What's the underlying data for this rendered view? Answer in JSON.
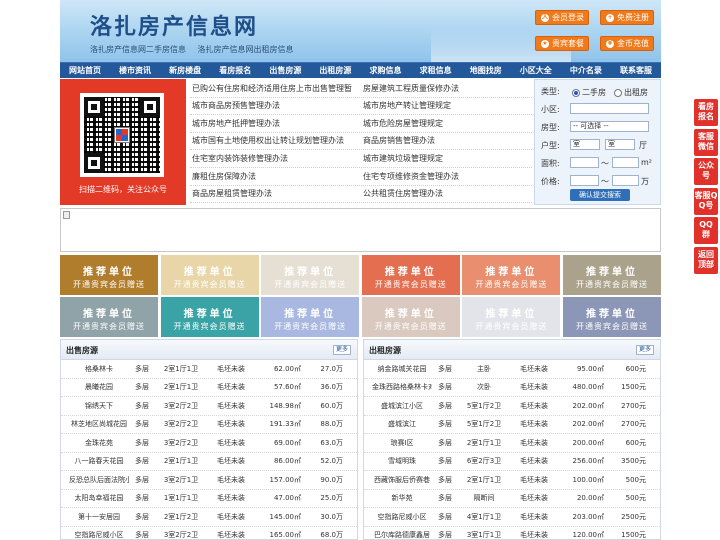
{
  "header": {
    "site_title": "洛扎房产信息网",
    "slogans": [
      "洛扎房产信息网二手房信息",
      "洛扎房产信息网出租房信息"
    ],
    "buttons": {
      "login": "会员登录",
      "register": "免费注册",
      "vip": "贵宾套餐",
      "recharge": "金币充值"
    }
  },
  "nav": [
    "网站首页",
    "楼市资讯",
    "新房楼盘",
    "看房报名",
    "出售房源",
    "出租房源",
    "求购信息",
    "求租信息",
    "地图找房",
    "小区大全",
    "中介名录",
    "联系客服"
  ],
  "qr": {
    "caption": "扫描二维码，关注公众号"
  },
  "links": [
    [
      "已购公有住房和经济适用住房上市出售管理暂",
      "房屋建筑工程质量保修办法"
    ],
    [
      "城市商品房预售管理办法",
      "城市房地产转让管理规定"
    ],
    [
      "城市房地产抵押管理办法",
      "城市危险房屋管理规定"
    ],
    [
      "城市国有土地使用权出让转让规划管理办法",
      "商品房销售管理办法"
    ],
    [
      "住宅室内装饰装修管理办法",
      "城市建筑垃圾管理规定"
    ],
    [
      "廉租住房保障办法",
      "住宅专项维修资金管理办法"
    ],
    [
      "商品房屋租赁管理办法",
      "公共租赁住房管理办法"
    ]
  ],
  "search": {
    "type_label": "类型:",
    "type_options": [
      "二手房",
      "出租房"
    ],
    "selected_type": "二手房",
    "community_label": "小区:",
    "house_label": "房型:",
    "house_select": "-- 可选择 --",
    "layout_label": "户型:",
    "room_select": "室",
    "hall_select": "室",
    "hall_unit": "厅",
    "area_label": "面积:",
    "area_sep": "〜",
    "area_unit": "m²",
    "price_label": "价格:",
    "price_sep": "〜",
    "price_unit": "万",
    "submit": "确认提交搜索"
  },
  "promo": {
    "title": "推荐单位",
    "subtitle": "开通贵宾会员赠送",
    "row1_colors": [
      "#b07d2c",
      "#e8d6a8",
      "#e6e0d4",
      "#e46f50",
      "#e98e6e",
      "#aaa28a"
    ],
    "row2_colors": [
      "#8fa3a8",
      "#3aa3a6",
      "#a9b8e0",
      "#d9c9bf",
      "#e2e4ea",
      "#8c96b6"
    ]
  },
  "sale": {
    "title": "出售房源",
    "more": "更多",
    "rows": [
      [
        "格桑林卡",
        "多层",
        "2室1厅1卫",
        "毛坯未装",
        "62.00㎡",
        "27.0万"
      ],
      [
        "晨曦花园",
        "多层",
        "2室1厅1卫",
        "毛坯未装",
        "57.60㎡",
        "36.0万"
      ],
      [
        "锦绣天下",
        "多层",
        "3室2厅2卫",
        "毛坯未装",
        "148.98㎡",
        "60.0万"
      ],
      [
        "林芝地区尚城花园",
        "多层",
        "3室2厅2卫",
        "毛坯未装",
        "191.33㎡",
        "88.0万"
      ],
      [
        "金珠花苑",
        "多层",
        "3室2厅2卫",
        "毛坯未装",
        "69.00㎡",
        "63.0万"
      ],
      [
        "八一路春天花园",
        "多层",
        "2室1厅1卫",
        "毛坯未装",
        "86.00㎡",
        "52.0万"
      ],
      [
        "反恐总队后面法院小区",
        "多层",
        "3室2厅1卫",
        "毛坯未装",
        "157.00㎡",
        "90.0万"
      ],
      [
        "太阳岛幸福花园",
        "多层",
        "1室1厅1卫",
        "毛坯未装",
        "47.00㎡",
        "25.0万"
      ],
      [
        "第十一安居园",
        "多层",
        "2室1厅2卫",
        "毛坯未装",
        "145.00㎡",
        "30.0万"
      ],
      [
        "空指路尼威小区",
        "多层",
        "3室2厅2卫",
        "毛坯未装",
        "165.00㎡",
        "68.0万"
      ]
    ]
  },
  "rent": {
    "title": "出租房源",
    "more": "更多",
    "rows": [
      [
        "纳金路城关花园",
        "多层",
        "主卧",
        "毛坯未装",
        "95.00㎡",
        "600元"
      ],
      [
        "金珠西路格桑林卡对面",
        "多层",
        "次卧",
        "毛坯未装",
        "480.00㎡",
        "1500元"
      ],
      [
        "盛城滨江小区",
        "多层",
        "5室1厅2卫",
        "毛坯未装",
        "202.00㎡",
        "2700元"
      ],
      [
        "盛城滨江",
        "多层",
        "5室1厅2卫",
        "毛坯未装",
        "202.00㎡",
        "2700元"
      ],
      [
        "琅赛I区",
        "多层",
        "2室1厅1卫",
        "毛坯未装",
        "200.00㎡",
        "600元"
      ],
      [
        "雪域明珠",
        "多层",
        "6室2厅3卫",
        "毛坯未装",
        "256.00㎡",
        "3500元"
      ],
      [
        "西藏饰服后侨赛巷",
        "多层",
        "2室1厅1卫",
        "毛坯未装",
        "100.00㎡",
        "500元"
      ],
      [
        "新华苑",
        "多层",
        "隔断间",
        "毛坯未装",
        "20.00㎡",
        "500元"
      ],
      [
        "空指路尼威小区",
        "多层",
        "4室1厅1卫",
        "毛坯未装",
        "203.00㎡",
        "2500元"
      ],
      [
        "巴尔库路德康鑫居",
        "多层",
        "3室1厅1卫",
        "毛坯未装",
        "120.00㎡",
        "1500元"
      ]
    ]
  },
  "sidebar": [
    "看房报名",
    "客服微信",
    "公众号",
    "客服QQ号",
    "QQ群",
    "返回顶部"
  ],
  "colors": {
    "nav": "#23589b",
    "accent": "#f07a1a",
    "sidebar": "#e0312a",
    "qr_bg": "#e33a27"
  }
}
